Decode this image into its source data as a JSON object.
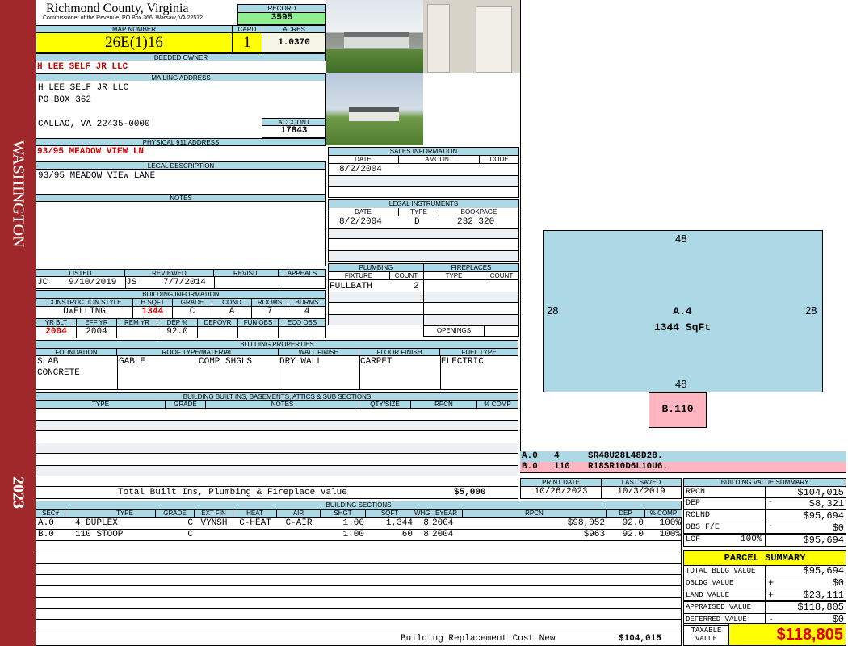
{
  "sidebar": {
    "district": "WASHINGTON",
    "year": "2023"
  },
  "header": {
    "title": "Richmond County, Virginia",
    "subtitle": "Commissioner of the Revenue, PO Box 366, Warsaw, VA 22572",
    "record_label": "RECORD",
    "record": "3595"
  },
  "ids": {
    "map_label": "MAP NUMBER",
    "map": "26E(1)16",
    "card_label": "CARD",
    "card": "1",
    "acres_label": "ACRES",
    "acres": "1.0370"
  },
  "owner": {
    "label": "DEEDED OWNER",
    "name": "H LEE SELF JR LLC",
    "mail_label": "MAILING ADDRESS",
    "mail1": "H LEE SELF JR LLC",
    "mail2": "PO BOX 362",
    "mail3": "CALLAO, VA 22435-0000",
    "account_label": "ACCOUNT",
    "account": "17843",
    "addr_label": "PHYSICAL 911 ADDRESS",
    "addr": "93/95 MEADOW VIEW LN"
  },
  "legal": {
    "label": "LEGAL DESCRIPTION",
    "value": "93/95 MEADOW VIEW LANE",
    "notes_label": "NOTES"
  },
  "listing": {
    "labels": [
      "LISTED",
      "REVIEWED",
      "REVISIT",
      "APPEALS"
    ],
    "listed_by": "JC",
    "listed_date": "9/10/2019",
    "reviewed_by": "JS",
    "reviewed_date": "7/7/2014"
  },
  "bldg_info": {
    "title": "BUILDING INFORMATION",
    "labels1": [
      "CONSTRUCTION STYLE",
      "H SQFT",
      "GRADE",
      "COND",
      "ROOMS",
      "BDRMS"
    ],
    "values1": [
      "DWELLING",
      "1344",
      "C",
      "A",
      "7",
      "4"
    ],
    "labels2": [
      "YR BLT",
      "EFF YR",
      "REM YR",
      "DEP %",
      "DEPOVR",
      "FUN OBS",
      "ECO OBS"
    ],
    "values2": [
      "2004",
      "2004",
      "",
      "92.0",
      "",
      "",
      ""
    ]
  },
  "props": {
    "title": "BUILDING PROPERTIES",
    "labels": [
      "FOUNDATION",
      "ROOF TYPE/MATERIAL",
      "WALL FINISH",
      "FLOOR FINISH",
      "FUEL TYPE"
    ],
    "foundation1": "SLAB",
    "foundation2": "CONCRETE",
    "roof_type": "GABLE",
    "roof_mat": "COMP SHGLS",
    "wall": "DRY WALL",
    "floor": "CARPET",
    "fuel": "ELECTRIC"
  },
  "builtins": {
    "title": "BUILDING BUILT INS, BASEMENTS, ATTICS & SUB SECTIONS",
    "labels": [
      "TYPE",
      "GRADE",
      "NOTES",
      "QTY/SIZE",
      "RPCN",
      "% COMP"
    ],
    "total_label": "Total Built Ins, Plumbing & Fireplace Value",
    "total": "$5,000"
  },
  "sales": {
    "title": "SALES INFORMATION",
    "labels": [
      "DATE",
      "AMOUNT",
      "CODE"
    ],
    "date": "8/2/2004"
  },
  "instruments": {
    "title": "LEGAL INSTRUMENTS",
    "labels": [
      "DATE",
      "TYPE",
      "BOOKPAGE"
    ],
    "date": "8/2/2004",
    "type": "D",
    "bookpage": "232 320"
  },
  "plumbing": {
    "title": "PLUMBING",
    "labels": [
      "FIXTURE",
      "COUNT"
    ],
    "fixture": "FULLBATH",
    "count": "2"
  },
  "fireplaces": {
    "title": "FIREPLACES",
    "labels": [
      "TYPE",
      "COUNT"
    ],
    "openings": "OPENINGS"
  },
  "sketch": {
    "top": "48",
    "bottom": "48",
    "left": "28",
    "right": "28",
    "a_label": "A.4",
    "a_area": "1344 SqFt",
    "b_label": "B.110",
    "rows": [
      {
        "sec": "A.0",
        "code": "4",
        "path": "SR48U28L48D28."
      },
      {
        "sec": "B.0",
        "code": "110",
        "path": "R18SR10D6L10U6."
      }
    ],
    "colors": {
      "a": "#add8e6",
      "b": "#ffb6c1"
    }
  },
  "dates": {
    "print_label": "PRINT DATE",
    "print": "10/26/2023",
    "saved_label": "LAST SAVED",
    "saved": "10/3/2019"
  },
  "sections": {
    "title": "BUILDING SECTIONS",
    "labels": [
      "SEC#",
      "TYPE",
      "GRADE",
      "EXT FIN",
      "HEAT",
      "AIR",
      "SHGT",
      "SQFT",
      "WHGT",
      "EYEAR",
      "RPCN",
      "DEP",
      "% COMP"
    ],
    "rows": [
      [
        "A.0",
        "4 DUPLEX",
        "C",
        "VYNSH",
        "C-HEAT",
        "C-AIR",
        "1.00",
        "1,344",
        "8",
        "2004",
        "$98,052",
        "92.0",
        "100%"
      ],
      [
        "B.0",
        "110 STOOP",
        "C",
        "",
        "",
        "",
        "1.00",
        "60",
        "8",
        "2004",
        "$963",
        "92.0",
        "100%"
      ]
    ],
    "total_label": "Building Replacement Cost New",
    "total": "$104,015"
  },
  "value_summary": {
    "title": "BUILDING VALUE SUMMARY",
    "rpcn_l": "RPCN",
    "rpcn": "$104,015",
    "dep_l": "DEP",
    "dep": "$8,321",
    "rclnd_l": "RCLND",
    "rclnd": "$95,694",
    "obs_l": "OBS F/E",
    "obs": "$0",
    "lcf_l": "LCF",
    "lcf_pct": "100%",
    "lcf": "$95,694",
    "minus": "-"
  },
  "parcel": {
    "title": "PARCEL SUMMARY",
    "bldg_l": "TOTAL BLDG VALUE",
    "bldg": "$95,694",
    "obldg_l": "OBLDG VALUE",
    "obldg": "$0",
    "land_l": "LAND VALUE",
    "land": "$23,111",
    "appr_l": "APPRAISED VALUE",
    "appr": "$118,805",
    "def_l": "DEFERRED VALUE",
    "def": "$0",
    "tax_l1": "TAXABLE",
    "tax_l2": "VALUE",
    "tax": "$118,805",
    "plus": "+",
    "minus": "-"
  }
}
